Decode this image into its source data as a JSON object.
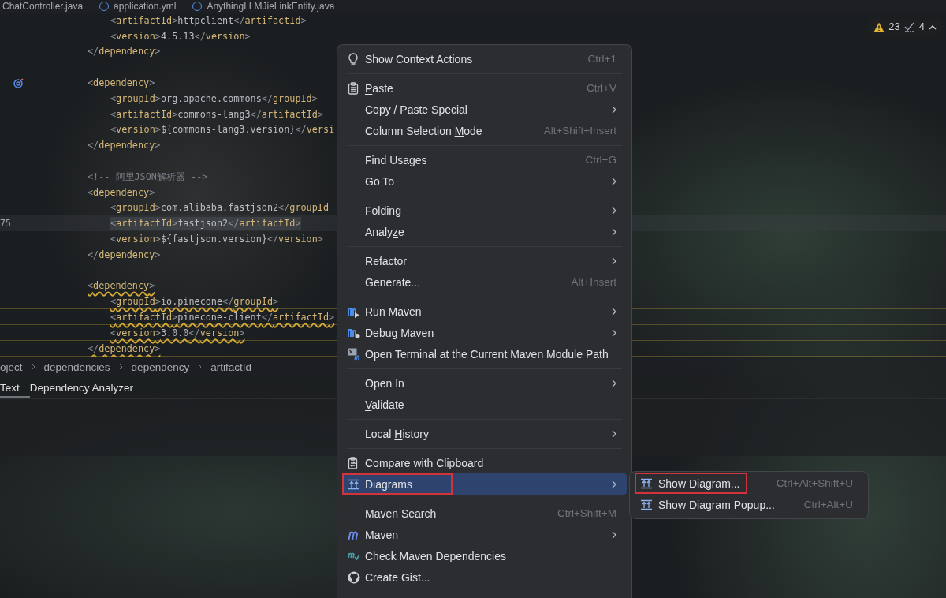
{
  "editor_tabs": [
    {
      "label": "ChatController.java",
      "selected": false
    },
    {
      "label": "application.yml",
      "selected": false
    },
    {
      "label": "AnythingLLMJieLinkEntity.java",
      "selected": false
    }
  ],
  "inspections": {
    "warnings": "23",
    "weak_warnings": "4"
  },
  "code_lines": [
    {
      "kind": "inner",
      "text": "<artifactId>httpclient</artifactId>",
      "warning": false,
      "current": false
    },
    {
      "kind": "inner",
      "text": "<version>4.5.13</version>",
      "warning": false,
      "current": false
    },
    {
      "kind": "outer",
      "text": "</dependency>",
      "warning": false,
      "current": false
    },
    {
      "kind": "blank"
    },
    {
      "kind": "marked",
      "text": "<dependency>",
      "warning": false,
      "current": false
    },
    {
      "kind": "inner",
      "text": "<groupId>org.apache.commons</groupId>",
      "warning": false,
      "current": false
    },
    {
      "kind": "inner",
      "text": "<artifactId>commons-lang3</artifactId>",
      "warning": false,
      "current": false
    },
    {
      "kind": "inner",
      "text": "<version>${commons-lang3.version}</versi",
      "warning": false,
      "current": false
    },
    {
      "kind": "outer",
      "text": "</dependency>",
      "warning": false,
      "current": false
    },
    {
      "kind": "blank"
    },
    {
      "kind": "comment",
      "text": "<!-- 阿里JSON解析器 -->",
      "warning": false,
      "current": false
    },
    {
      "kind": "outer",
      "text": "<dependency>",
      "warning": false,
      "current": false
    },
    {
      "kind": "inner",
      "text": "<groupId>com.alibaba.fastjson2</groupId",
      "warning": false,
      "current": false
    },
    {
      "kind": "inner",
      "number": "75",
      "text": "<artifactId>fastjson2</artifactId>",
      "warning": false,
      "current": true
    },
    {
      "kind": "inner",
      "text": "<version>${fastjson.version}</version>",
      "warning": false,
      "current": false
    },
    {
      "kind": "outer",
      "text": "</dependency>",
      "warning": false,
      "current": false
    },
    {
      "kind": "blank"
    },
    {
      "kind": "outer",
      "text": "<dependency>",
      "warning": true,
      "current": false
    },
    {
      "kind": "inner",
      "text": "<groupId>io.pinecone</groupId>",
      "warning": true,
      "current": false
    },
    {
      "kind": "inner",
      "text": "<artifactId>pinecone-client</artifactId>",
      "warning": true,
      "current": false
    },
    {
      "kind": "inner",
      "text": "<version>3.0.0</version>",
      "warning": true,
      "current": false
    },
    {
      "kind": "outer",
      "text": "</dependency>",
      "warning": true,
      "current": false
    }
  ],
  "breadcrumb": [
    "oject",
    "dependencies",
    "dependency",
    "artifactId"
  ],
  "tool_tabs": [
    {
      "label": "Text",
      "selected": true
    },
    {
      "label": "Dependency Analyzer",
      "selected": false
    }
  ],
  "context_menu": {
    "groups": [
      [
        {
          "kind": "bulb",
          "label": "Show Context Actions",
          "shortcut": "Ctrl+1",
          "submenu": false,
          "selected": false,
          "outlined": false
        }
      ],
      [
        {
          "kind": "clipboard",
          "mnemonic": "P",
          "label_rest": "aste",
          "shortcut": "Ctrl+V",
          "submenu": false,
          "selected": false,
          "outlined": false
        },
        {
          "kind": "plain",
          "label": "Copy / Paste Special",
          "submenu": true,
          "selected": false,
          "outlined": false
        },
        {
          "kind": "plain",
          "label": "Column Selection ",
          "mnemonic": "M",
          "label_rest": "ode",
          "shortcut": "Alt+Shift+Insert",
          "submenu": false,
          "selected": false,
          "outlined": false
        }
      ],
      [
        {
          "kind": "plain",
          "label": "Find ",
          "mnemonic": "U",
          "label_rest": "sages",
          "shortcut": "Ctrl+G",
          "submenu": false,
          "selected": false,
          "outlined": false
        },
        {
          "kind": "plain",
          "label": "Go To",
          "submenu": true,
          "selected": false,
          "outlined": false
        }
      ],
      [
        {
          "kind": "plain",
          "label": "Folding",
          "submenu": true,
          "selected": false,
          "outlined": false
        },
        {
          "kind": "plain",
          "label": "Analy",
          "mnemonic": "z",
          "label_rest": "e",
          "submenu": true,
          "selected": false,
          "outlined": false
        }
      ],
      [
        {
          "kind": "plain",
          "mnemonic": "R",
          "label_rest": "efactor",
          "submenu": true,
          "selected": false,
          "outlined": false
        },
        {
          "kind": "plain",
          "label": "Generate...",
          "shortcut": "Alt+Insert",
          "submenu": false,
          "selected": false,
          "outlined": false
        }
      ],
      [
        {
          "kind": "maven-run",
          "label": "Run Maven",
          "submenu": true,
          "selected": false,
          "outlined": false
        },
        {
          "kind": "maven-debug",
          "label": "Debug Maven",
          "submenu": true,
          "selected": false,
          "outlined": false
        },
        {
          "kind": "maven-terminal",
          "label": "Open Terminal at the Current Maven Module Path",
          "submenu": false,
          "selected": false,
          "outlined": false
        }
      ],
      [
        {
          "kind": "plain",
          "label": "Open In",
          "submenu": true,
          "selected": false,
          "outlined": false
        },
        {
          "kind": "plain",
          "mnemonic": "V",
          "label_rest": "alidate",
          "submenu": false,
          "selected": false,
          "outlined": false
        }
      ],
      [
        {
          "kind": "plain",
          "label": "Local ",
          "mnemonic": "H",
          "label_rest": "istory",
          "submenu": true,
          "selected": false,
          "outlined": false
        }
      ],
      [
        {
          "kind": "compare",
          "label": "Compare with Clip",
          "mnemonic": "b",
          "label_rest": "oard",
          "submenu": false,
          "selected": false,
          "outlined": false
        },
        {
          "kind": "diagram",
          "label": "Diagrams",
          "submenu": true,
          "selected": true,
          "outlined": true
        }
      ],
      [
        {
          "kind": "plain",
          "label": "Maven Search",
          "shortcut": "Ctrl+Shift+M",
          "submenu": false,
          "selected": false,
          "outlined": false
        },
        {
          "kind": "maven",
          "label": "Maven",
          "submenu": true,
          "selected": false,
          "outlined": false
        },
        {
          "kind": "maven-check",
          "label": "Check Maven Dependencies",
          "submenu": false,
          "selected": false,
          "outlined": false
        },
        {
          "kind": "github",
          "label": "Create Gist...",
          "submenu": false,
          "selected": false,
          "outlined": false
        }
      ]
    ]
  },
  "submenu": {
    "items": [
      {
        "kind": "diagram",
        "label": "Show Diagram...",
        "shortcut": "Ctrl+Alt+Shift+U",
        "selected": false,
        "outlined": true
      },
      {
        "kind": "diagram",
        "label": "Show Diagram Popup...",
        "shortcut": "Ctrl+Alt+U",
        "selected": false,
        "outlined": false
      }
    ]
  }
}
